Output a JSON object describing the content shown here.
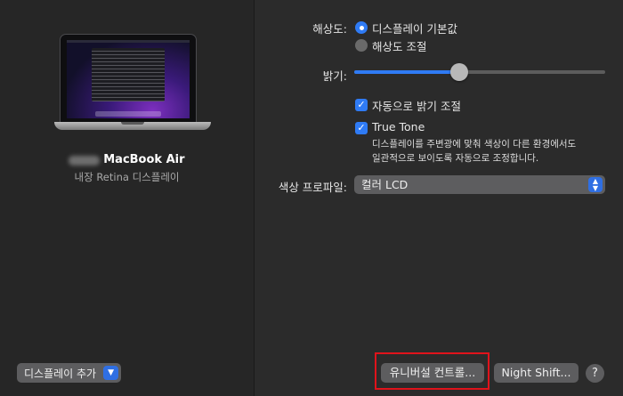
{
  "device": {
    "name": "MacBook Air",
    "blurred_owner": "████",
    "subtitle": "내장 Retina 디스플레이"
  },
  "add_display": {
    "label": "디스플레이 추가"
  },
  "resolution": {
    "label": "해상도:",
    "options": [
      "디스플레이 기본값",
      "해상도 조절"
    ],
    "selected": "디스플레이 기본값"
  },
  "brightness": {
    "label": "밝기:",
    "level": 0.42
  },
  "auto_brightness": {
    "label": "자동으로 밝기 조절",
    "checked": true
  },
  "true_tone": {
    "label": "True Tone",
    "checked": true,
    "description_line1": "디스플레이를 주변광에 맞춰 색상이 다른 환경에서도",
    "description_line2": "일관적으로 보이도록 자동으로 조정합니다."
  },
  "color_profile": {
    "label": "색상 프로파일:",
    "value": "컬러 LCD"
  },
  "buttons": {
    "universal_control": "유니버설 컨트롤...",
    "night_shift": "Night Shift...",
    "help": "?"
  },
  "colors": {
    "accent": "#2f7bf5",
    "highlight": "#e0131b"
  }
}
